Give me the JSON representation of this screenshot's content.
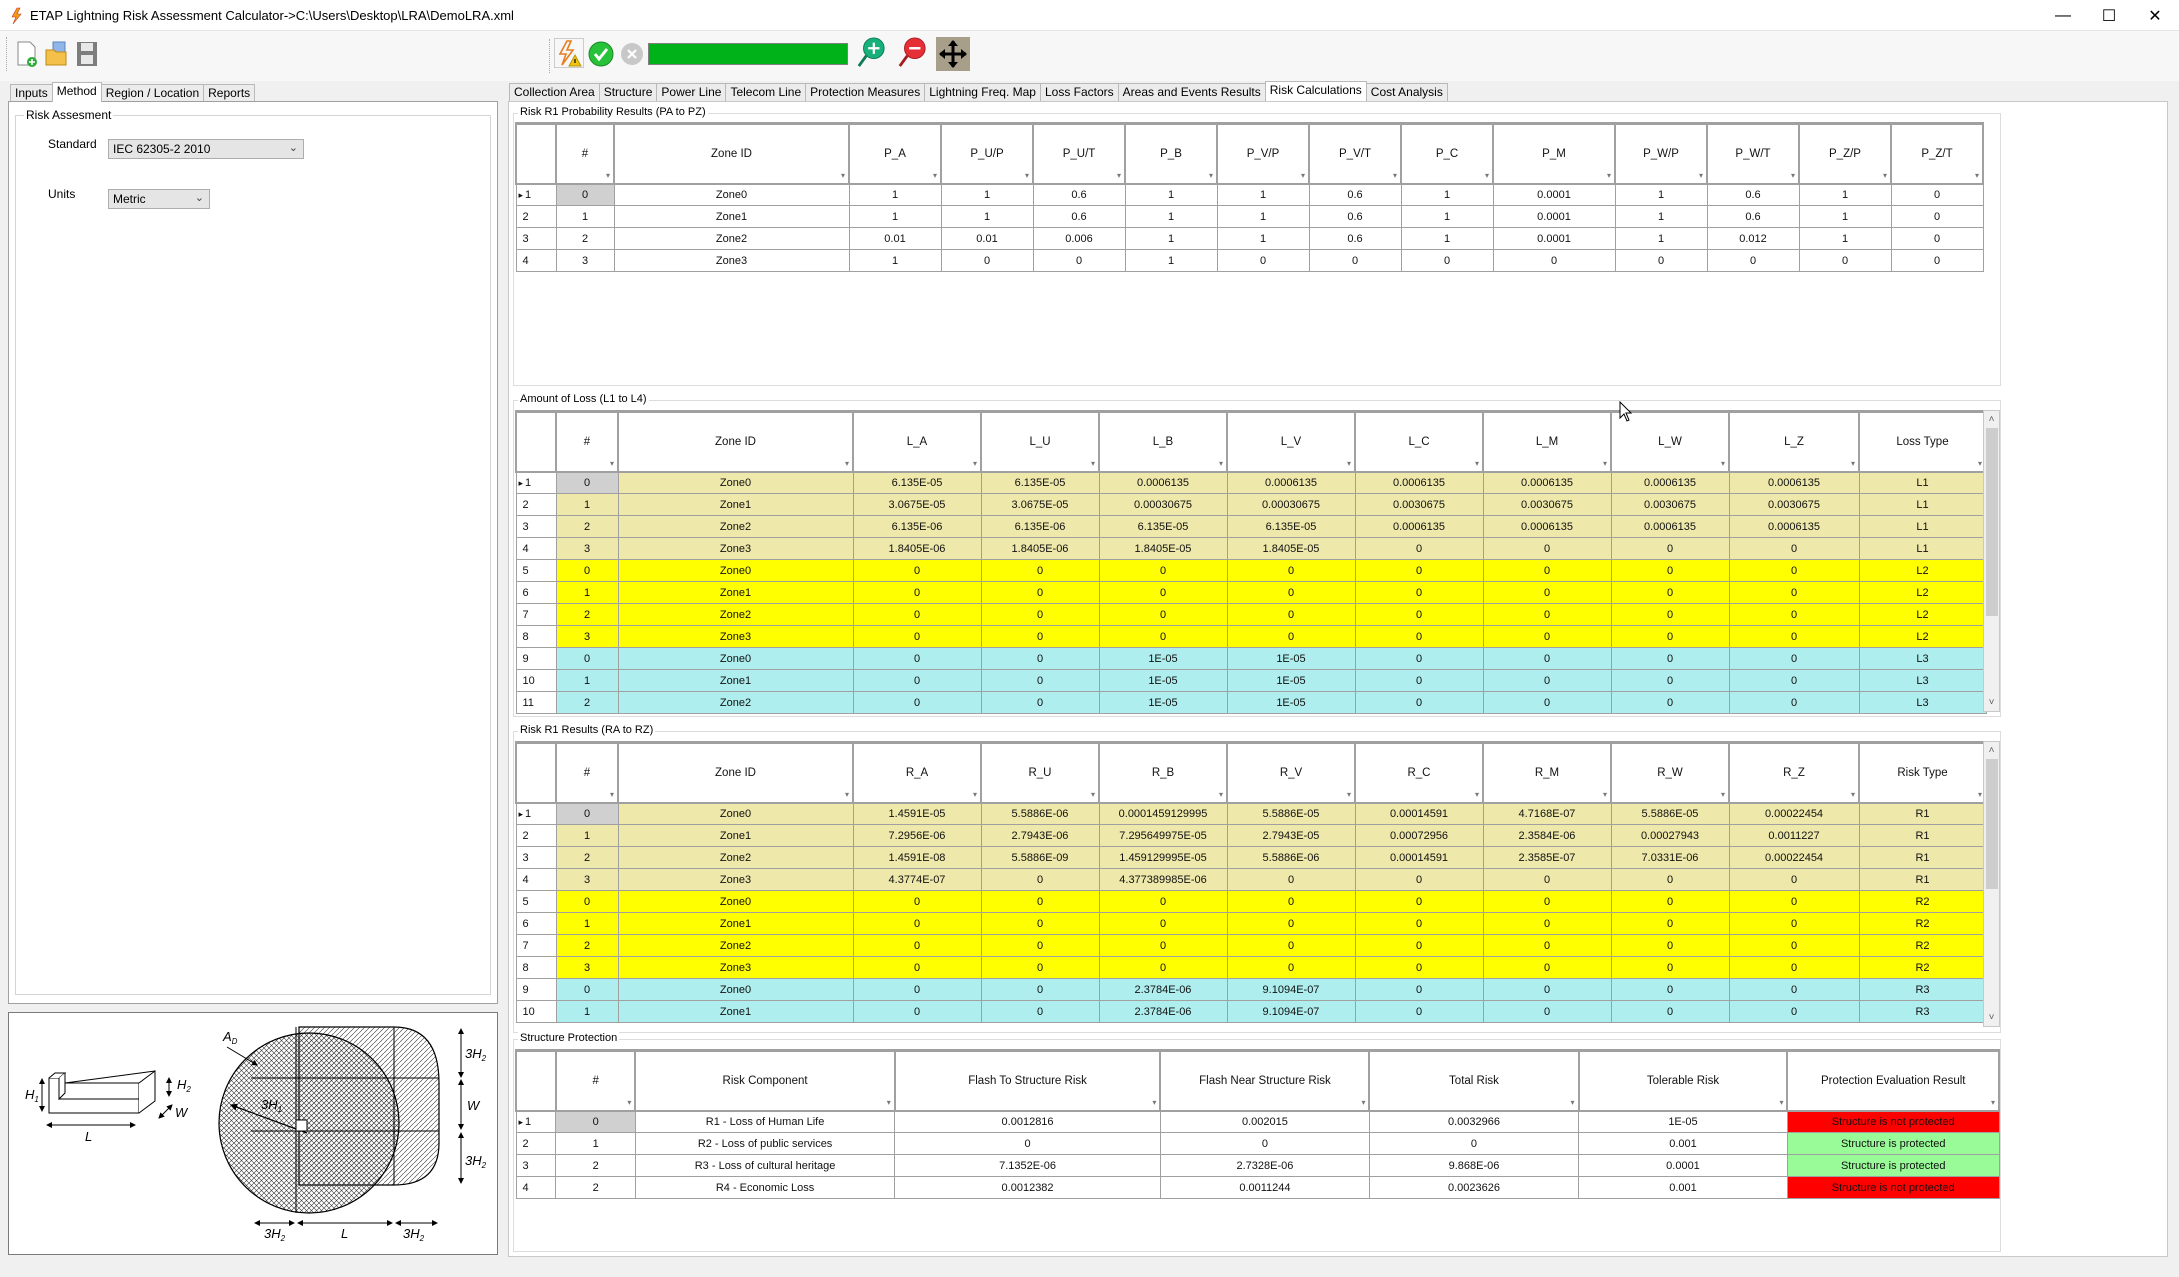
{
  "window": {
    "title": "ETAP Lightning Risk Assessment Calculator->C:\\Users\\Desktop\\LRA\\DemoLRA.xml",
    "app_icon": "lightning-icon",
    "controls": {
      "minimize": "—",
      "maximize": "☐",
      "close": "✕"
    }
  },
  "toolbar": {
    "left_icons": [
      "new-file-icon",
      "open-file-icon",
      "save-icon"
    ],
    "right_icons": [
      "lightning-warning-icon",
      "run-check-icon",
      "stop-icon",
      "zoom-in-icon",
      "zoom-out-icon",
      "pan-icon"
    ],
    "progress_percent": 100,
    "progress_color": "#00b21a"
  },
  "left_tabs": [
    {
      "label": "Inputs",
      "active": false
    },
    {
      "label": "Method",
      "active": true
    },
    {
      "label": "Region / Location",
      "active": false
    },
    {
      "label": "Reports",
      "active": false
    }
  ],
  "method": {
    "group_title": "Risk Assesment",
    "standard_label": "Standard",
    "standard_value": "IEC 62305-2 2010",
    "units_label": "Units",
    "units_value": "Metric"
  },
  "diagram": {
    "labels": {
      "ad": "A",
      "ad_sub": "D",
      "h1": "H",
      "h1_sub": "1",
      "h2": "H",
      "h2_sub": "2",
      "w": "W",
      "l": "L",
      "three_h1": "3H",
      "three_h2": "3H"
    }
  },
  "right_tabs": [
    {
      "label": "Collection Area",
      "active": false
    },
    {
      "label": "Structure",
      "active": false
    },
    {
      "label": "Power Line",
      "active": false
    },
    {
      "label": "Telecom Line",
      "active": false
    },
    {
      "label": "Protection Measures",
      "active": false
    },
    {
      "label": "Lightning Freq. Map",
      "active": false
    },
    {
      "label": "Loss Factors",
      "active": false
    },
    {
      "label": "Areas and Events Results",
      "active": false
    },
    {
      "label": "Risk Calculations",
      "active": true
    },
    {
      "label": "Cost Analysis",
      "active": false
    }
  ],
  "colors": {
    "row_l1": "#eee8aa",
    "row_l2": "#ffff00",
    "row_l3": "#afeeee",
    "not_protected": "#ff0000",
    "protected": "#98fb98"
  },
  "probability": {
    "title": "Risk R1 Probability Results (PA to PZ)",
    "columns": [
      "#",
      "Zone ID",
      "P_A",
      "P_U/P",
      "P_U/T",
      "P_B",
      "P_V/P",
      "P_V/T",
      "P_C",
      "P_M",
      "P_W/P",
      "P_W/T",
      "P_Z/P",
      "P_Z/T"
    ],
    "rows": [
      [
        "1",
        "0",
        "Zone0",
        "1",
        "1",
        "0.6",
        "1",
        "1",
        "0.6",
        "1",
        "0.0001",
        "1",
        "0.6",
        "1",
        "0"
      ],
      [
        "2",
        "1",
        "Zone1",
        "1",
        "1",
        "0.6",
        "1",
        "1",
        "0.6",
        "1",
        "0.0001",
        "1",
        "0.6",
        "1",
        "0"
      ],
      [
        "3",
        "2",
        "Zone2",
        "0.01",
        "0.01",
        "0.006",
        "1",
        "1",
        "0.6",
        "1",
        "0.0001",
        "1",
        "0.012",
        "1",
        "0"
      ],
      [
        "4",
        "3",
        "Zone3",
        "1",
        "0",
        "0",
        "1",
        "0",
        "0",
        "0",
        "0",
        "0",
        "0",
        "0",
        "0"
      ]
    ]
  },
  "loss": {
    "title": "Amount of Loss (L1 to L4)",
    "columns": [
      "#",
      "Zone ID",
      "L_A",
      "L_U",
      "L_B",
      "L_V",
      "L_C",
      "L_M",
      "L_W",
      "L_Z",
      "Loss Type"
    ],
    "rows": [
      [
        "1",
        "0",
        "Zone0",
        "6.135E-05",
        "6.135E-05",
        "0.0006135",
        "0.0006135",
        "0.0006135",
        "0.0006135",
        "0.0006135",
        "0.0006135",
        "L1"
      ],
      [
        "2",
        "1",
        "Zone1",
        "3.0675E-05",
        "3.0675E-05",
        "0.00030675",
        "0.00030675",
        "0.0030675",
        "0.0030675",
        "0.0030675",
        "0.0030675",
        "L1"
      ],
      [
        "3",
        "2",
        "Zone2",
        "6.135E-06",
        "6.135E-06",
        "6.135E-05",
        "6.135E-05",
        "0.0006135",
        "0.0006135",
        "0.0006135",
        "0.0006135",
        "L1"
      ],
      [
        "4",
        "3",
        "Zone3",
        "1.8405E-06",
        "1.8405E-06",
        "1.8405E-05",
        "1.8405E-05",
        "0",
        "0",
        "0",
        "0",
        "L1"
      ],
      [
        "5",
        "0",
        "Zone0",
        "0",
        "0",
        "0",
        "0",
        "0",
        "0",
        "0",
        "0",
        "L2"
      ],
      [
        "6",
        "1",
        "Zone1",
        "0",
        "0",
        "0",
        "0",
        "0",
        "0",
        "0",
        "0",
        "L2"
      ],
      [
        "7",
        "2",
        "Zone2",
        "0",
        "0",
        "0",
        "0",
        "0",
        "0",
        "0",
        "0",
        "L2"
      ],
      [
        "8",
        "3",
        "Zone3",
        "0",
        "0",
        "0",
        "0",
        "0",
        "0",
        "0",
        "0",
        "L2"
      ],
      [
        "9",
        "0",
        "Zone0",
        "0",
        "0",
        "1E-05",
        "1E-05",
        "0",
        "0",
        "0",
        "0",
        "L3"
      ],
      [
        "10",
        "1",
        "Zone1",
        "0",
        "0",
        "1E-05",
        "1E-05",
        "0",
        "0",
        "0",
        "0",
        "L3"
      ],
      [
        "11",
        "2",
        "Zone2",
        "0",
        "0",
        "1E-05",
        "1E-05",
        "0",
        "0",
        "0",
        "0",
        "L3"
      ]
    ]
  },
  "risk": {
    "title": "Risk R1 Results (RA to RZ)",
    "columns": [
      "#",
      "Zone ID",
      "R_A",
      "R_U",
      "R_B",
      "R_V",
      "R_C",
      "R_M",
      "R_W",
      "R_Z",
      "Risk Type"
    ],
    "rows": [
      [
        "1",
        "0",
        "Zone0",
        "1.4591E-05",
        "5.5886E-06",
        "0.0001459129995",
        "5.5886E-05",
        "0.00014591",
        "4.7168E-07",
        "5.5886E-05",
        "0.00022454",
        "R1"
      ],
      [
        "2",
        "1",
        "Zone1",
        "7.2956E-06",
        "2.7943E-06",
        "7.295649975E-05",
        "2.7943E-05",
        "0.00072956",
        "2.3584E-06",
        "0.00027943",
        "0.0011227",
        "R1"
      ],
      [
        "3",
        "2",
        "Zone2",
        "1.4591E-08",
        "5.5886E-09",
        "1.459129995E-05",
        "5.5886E-06",
        "0.00014591",
        "2.3585E-07",
        "7.0331E-06",
        "0.00022454",
        "R1"
      ],
      [
        "4",
        "3",
        "Zone3",
        "4.3774E-07",
        "0",
        "4.377389985E-06",
        "0",
        "0",
        "0",
        "0",
        "0",
        "R1"
      ],
      [
        "5",
        "0",
        "Zone0",
        "0",
        "0",
        "0",
        "0",
        "0",
        "0",
        "0",
        "0",
        "R2"
      ],
      [
        "6",
        "1",
        "Zone1",
        "0",
        "0",
        "0",
        "0",
        "0",
        "0",
        "0",
        "0",
        "R2"
      ],
      [
        "7",
        "2",
        "Zone2",
        "0",
        "0",
        "0",
        "0",
        "0",
        "0",
        "0",
        "0",
        "R2"
      ],
      [
        "8",
        "3",
        "Zone3",
        "0",
        "0",
        "0",
        "0",
        "0",
        "0",
        "0",
        "0",
        "R2"
      ],
      [
        "9",
        "0",
        "Zone0",
        "0",
        "0",
        "2.3784E-06",
        "9.1094E-07",
        "0",
        "0",
        "0",
        "0",
        "R3"
      ],
      [
        "10",
        "1",
        "Zone1",
        "0",
        "0",
        "2.3784E-06",
        "9.1094E-07",
        "0",
        "0",
        "0",
        "0",
        "R3"
      ]
    ]
  },
  "protection": {
    "title": "Structure Protection",
    "columns": [
      "#",
      "Risk Component",
      "Flash To Structure Risk",
      "Flash Near Structure Risk",
      "Total Risk",
      "Tolerable Risk",
      "Protection Evaluation Result"
    ],
    "rows": [
      [
        "1",
        "0",
        "R1 - Loss of Human Life",
        "0.0012816",
        "0.002015",
        "0.0032966",
        "1E-05",
        "Structure is not protected"
      ],
      [
        "2",
        "1",
        "R2 - Loss of public services",
        "0",
        "0",
        "0",
        "0.001",
        "Structure is protected"
      ],
      [
        "3",
        "2",
        "R3 - Loss of cultural heritage",
        "7.1352E-06",
        "2.7328E-06",
        "9.868E-06",
        "0.0001",
        "Structure is protected"
      ],
      [
        "4",
        "2",
        "R4 - Economic Loss",
        "0.0012382",
        "0.0011244",
        "0.0023626",
        "0.001",
        "Structure is not protected"
      ]
    ]
  },
  "scrollbars": {
    "up": "˄",
    "down": "˅"
  },
  "sort_glyph": "▾",
  "current_row_glyph": "▸"
}
